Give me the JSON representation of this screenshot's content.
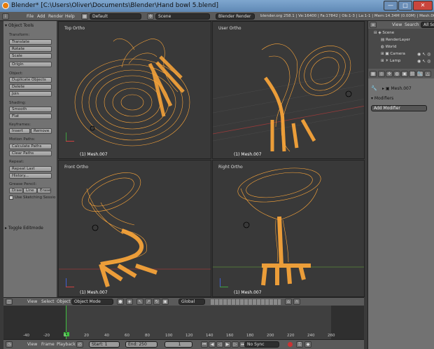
{
  "window": {
    "title": "Blender* [C:\\Users\\Oliver\\Documents\\Blender\\Hand bowl 5.blend]",
    "minimize": "—",
    "maximize": "□",
    "close": "✕"
  },
  "info_header": {
    "menus": [
      "File",
      "Add",
      "Render",
      "Help"
    ],
    "screen_layout": "Default",
    "scene": "Scene",
    "render_engine": "Blender Render",
    "stats": "blender.org 258.1 | Ve:16400 | Fa:17842 | Ob:1-3 | La:1-1 | Mem:14.34M (0.00M) | Mesh.007"
  },
  "tool_shelf": {
    "panel_title": "Object Tools",
    "sections": {
      "transform": {
        "label": "Transform:",
        "buttons": [
          "Translate",
          "Rotate",
          "Scale"
        ],
        "origin": "Origin"
      },
      "object": {
        "label": "Object:",
        "buttons": [
          "Duplicate Objects",
          "Delete",
          "Join"
        ]
      },
      "shading": {
        "label": "Shading:",
        "buttons": [
          "Smooth",
          "Flat"
        ]
      },
      "keyframes": {
        "label": "Keyframes:",
        "insert": "Insert",
        "remove": "Remove"
      },
      "motion_paths": {
        "label": "Motion Paths:",
        "buttons": [
          "Calculate Paths",
          "Clear Paths"
        ]
      },
      "repeat": {
        "label": "Repeat:",
        "buttons": [
          "Repeat Last",
          "History..."
        ]
      },
      "grease_pencil": {
        "label": "Grease Pencil:",
        "draw": "Draw",
        "line": "Line",
        "erase": "Erase",
        "use_sketching": "Use Sketching Sessio"
      }
    },
    "toggle_editmode": "Toggle Editmode"
  },
  "viewports": [
    {
      "label": "Top Ortho",
      "object": "(1) Mesh.007"
    },
    {
      "label": "User Ortho",
      "object": "(1) Mesh.007"
    },
    {
      "label": "Front Ortho",
      "object": "(1) Mesh.007"
    },
    {
      "label": "Right Ortho",
      "object": "(1) Mesh.007"
    }
  ],
  "view3d_header": {
    "menus": [
      "View",
      "Select",
      "Object"
    ],
    "mode": "Object Mode",
    "transform_orientation": "Global"
  },
  "timeline": {
    "ticks": [
      "-40",
      "-20",
      "0",
      "20",
      "40",
      "60",
      "80",
      "100",
      "120",
      "140",
      "160",
      "180",
      "200",
      "220",
      "240",
      "260"
    ],
    "current_frame_marker": "1",
    "menus": [
      "View",
      "Frame",
      "Playback"
    ],
    "start": "Start: 1",
    "end": "End: 250",
    "current": "1",
    "sync": "No Sync"
  },
  "outliner": {
    "menus": [
      "View",
      "Search"
    ],
    "filter": "All Sce",
    "items": [
      "Scene",
      "RenderLayer",
      "World",
      "Camera",
      "Lamp"
    ]
  },
  "properties": {
    "object_name": "Mesh.007",
    "panel_title": "Modifiers",
    "add_modifier": "Add Modifier"
  },
  "colors": {
    "wire": "#ffa83a",
    "bg_viewport": "#393939",
    "grid_x_axis": "#9a3a3a",
    "grid_y_axis": "#5a8a3a",
    "frame_cursor": "#3fbf3f"
  }
}
